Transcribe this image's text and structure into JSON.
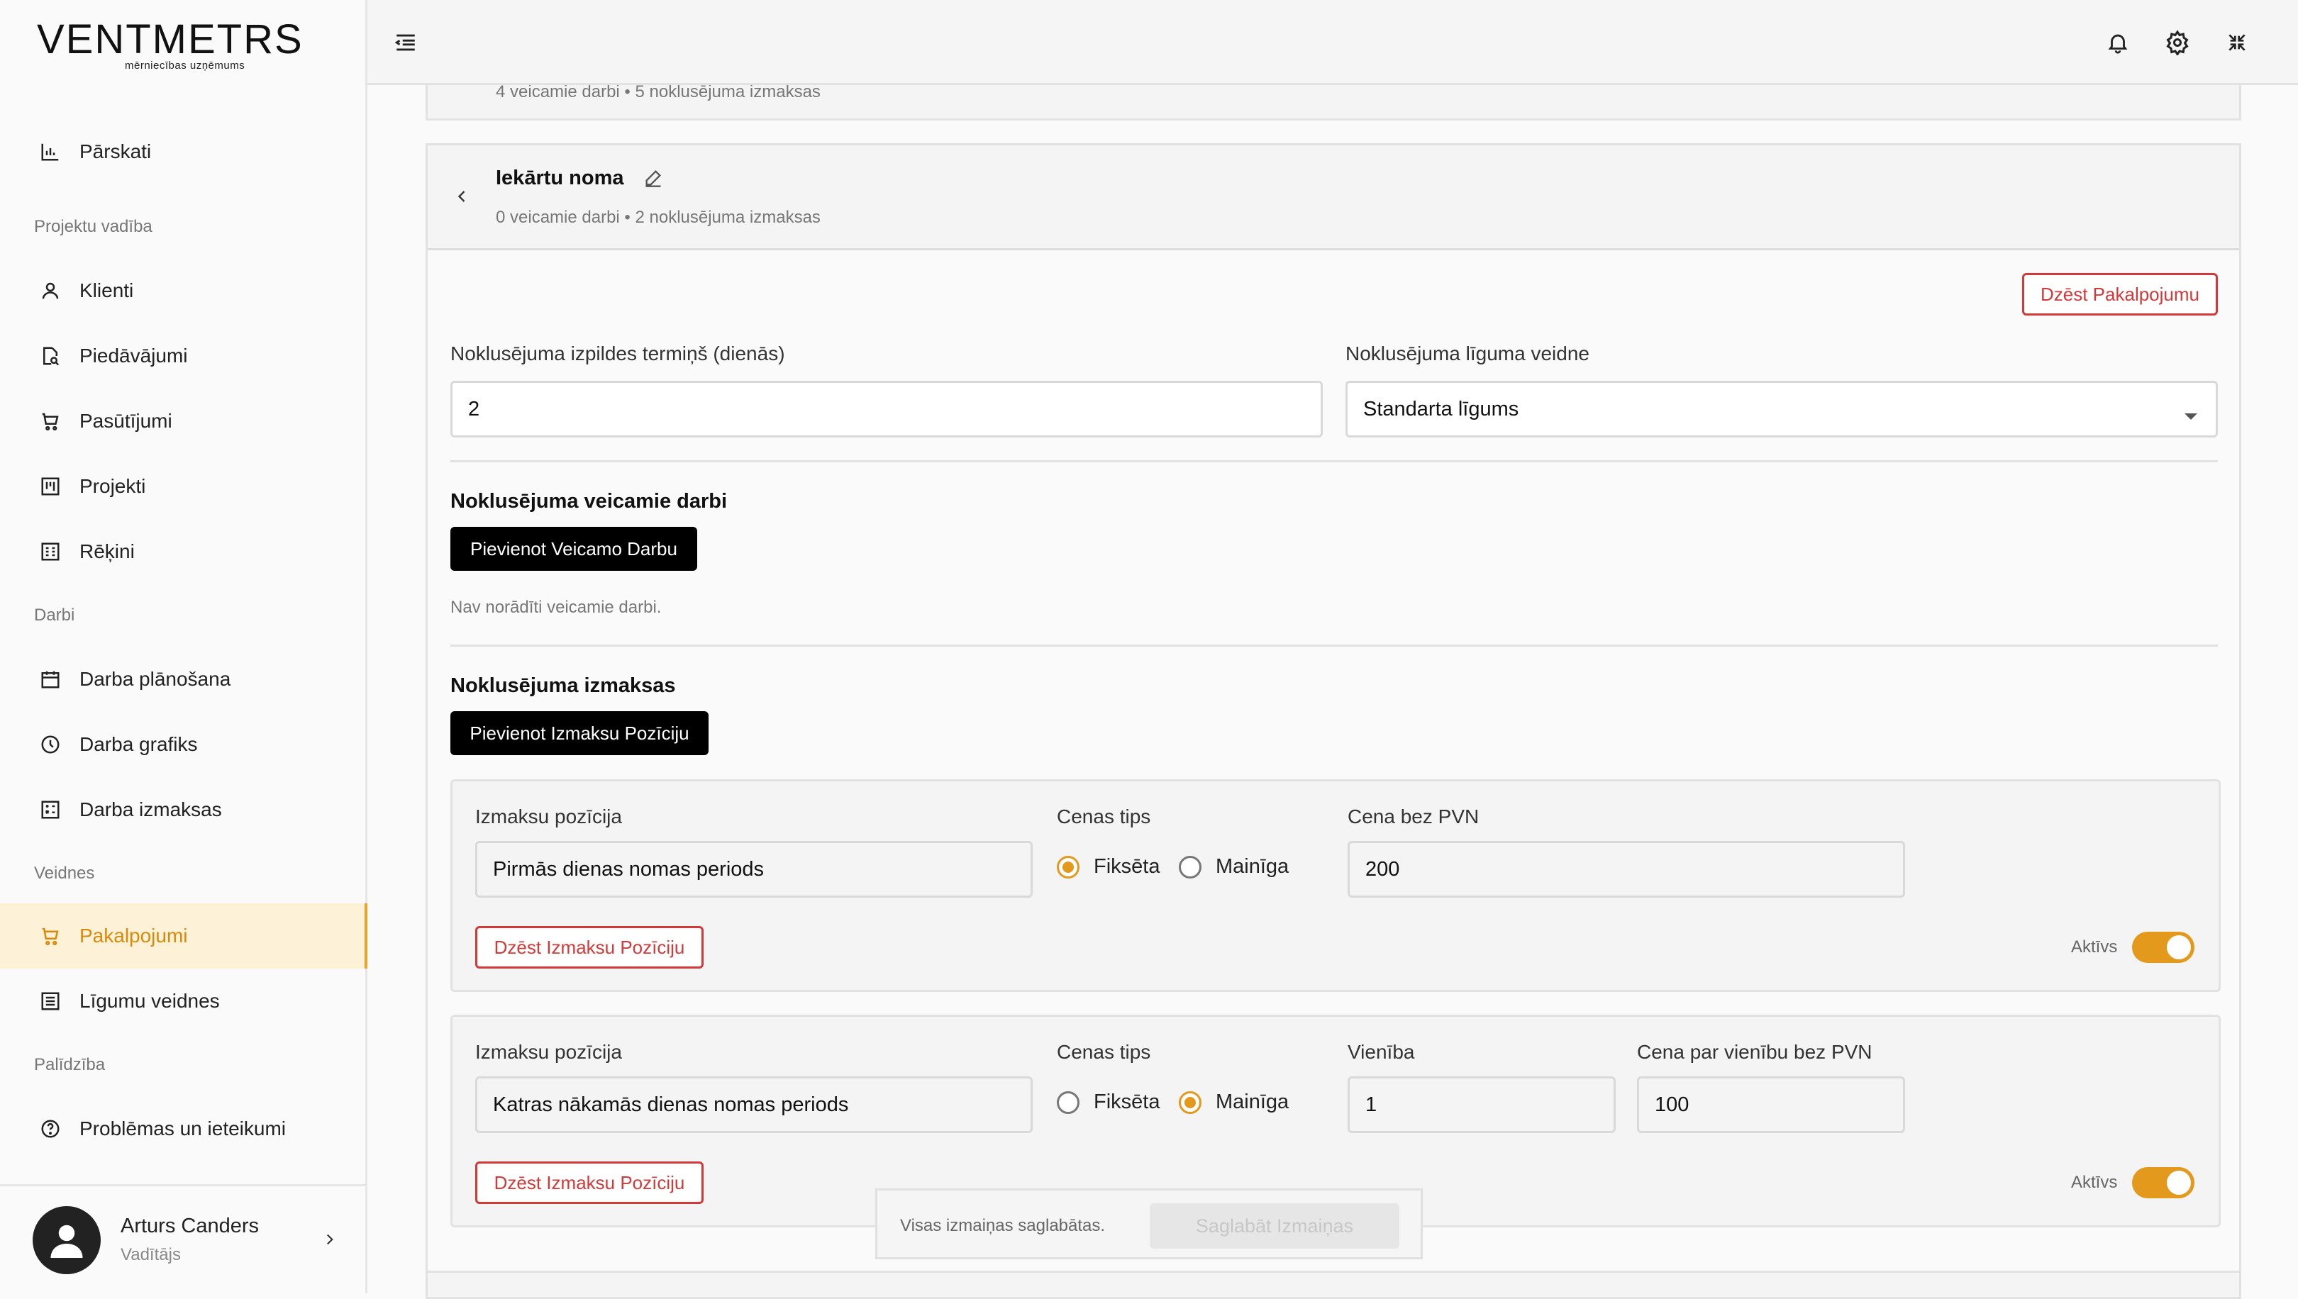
{
  "brand": {
    "logo": "VENTMETRS",
    "tagline": "mērniecības uzņēmums"
  },
  "sidebar": {
    "items": [
      {
        "label": "Pārskati",
        "icon": "bar-chart-icon"
      },
      {
        "section": "Projektu vadība"
      },
      {
        "label": "Klienti",
        "icon": "user-icon"
      },
      {
        "label": "Piedāvājumi",
        "icon": "document-search-icon"
      },
      {
        "label": "Pasūtījumi",
        "icon": "cart-icon"
      },
      {
        "label": "Projekti",
        "icon": "board-icon"
      },
      {
        "label": "Rēķini",
        "icon": "invoice-icon"
      },
      {
        "section": "Darbi"
      },
      {
        "label": "Darba plānošana",
        "icon": "calendar-icon"
      },
      {
        "label": "Darba grafiks",
        "icon": "clock-icon"
      },
      {
        "label": "Darba izmaksas",
        "icon": "calculator-icon"
      },
      {
        "section": "Veidnes"
      },
      {
        "label": "Pakalpojumi",
        "icon": "cart-icon",
        "active": true
      },
      {
        "label": "Līgumu veidnes",
        "icon": "list-icon"
      },
      {
        "section": "Palīdzība"
      },
      {
        "label": "Problēmas un ieteikumi",
        "icon": "help-icon"
      }
    ],
    "user": {
      "name": "Arturs Canders",
      "role": "Vadītājs"
    }
  },
  "prev_card": {
    "meta": "4 veicamie darbi • 5 noklusējuma izmaksas"
  },
  "service": {
    "title": "Iekārtu noma",
    "meta": "0 veicamie darbi • 2 noklusējuma izmaksas",
    "delete_label": "Dzēst Pakalpojumu",
    "term_label": "Noklusējuma izpildes termiņš (dienās)",
    "term_value": "2",
    "template_label": "Noklusējuma līguma veidne",
    "template_value": "Standarta līgums",
    "works_heading": "Noklusējuma veicamie darbi",
    "add_work_label": "Pievienot Veicamo Darbu",
    "no_works": "Nav norādīti veicamie darbi.",
    "costs_heading": "Noklusējuma izmaksas",
    "add_cost_label": "Pievienot Izmaksu Pozīciju",
    "costs": [
      {
        "position_label": "Izmaksu pozīcija",
        "position_value": "Pirmās dienas nomas periods",
        "price_type_label": "Cenas tips",
        "fixed_label": "Fiksēta",
        "variable_label": "Mainīga",
        "selected": "Fiksēta",
        "price_label": "Cena bez PVN",
        "price_value": "200",
        "delete_label": "Dzēst Izmaksu Pozīciju",
        "active_label": "Aktīvs",
        "active": true
      },
      {
        "position_label": "Izmaksu pozīcija",
        "position_value": "Katras nākamās dienas nomas periods",
        "price_type_label": "Cenas tips",
        "fixed_label": "Fiksēta",
        "variable_label": "Mainīga",
        "selected": "Mainīga",
        "unit_label": "Vienība",
        "unit_value": "1",
        "unit_price_label": "Cena par vienību bez PVN",
        "unit_price_value": "100",
        "delete_label": "Dzēst Izmaksu Pozīciju",
        "active_label": "Aktīvs",
        "active": true
      }
    ]
  },
  "savebar": {
    "status": "Visas izmaiņas saglabātas.",
    "save_label": "Saglabāt Izmaiņas"
  },
  "colors": {
    "accent": "#e39a1c",
    "danger": "#d23a3a",
    "active_bg": "#fdf1d8"
  }
}
